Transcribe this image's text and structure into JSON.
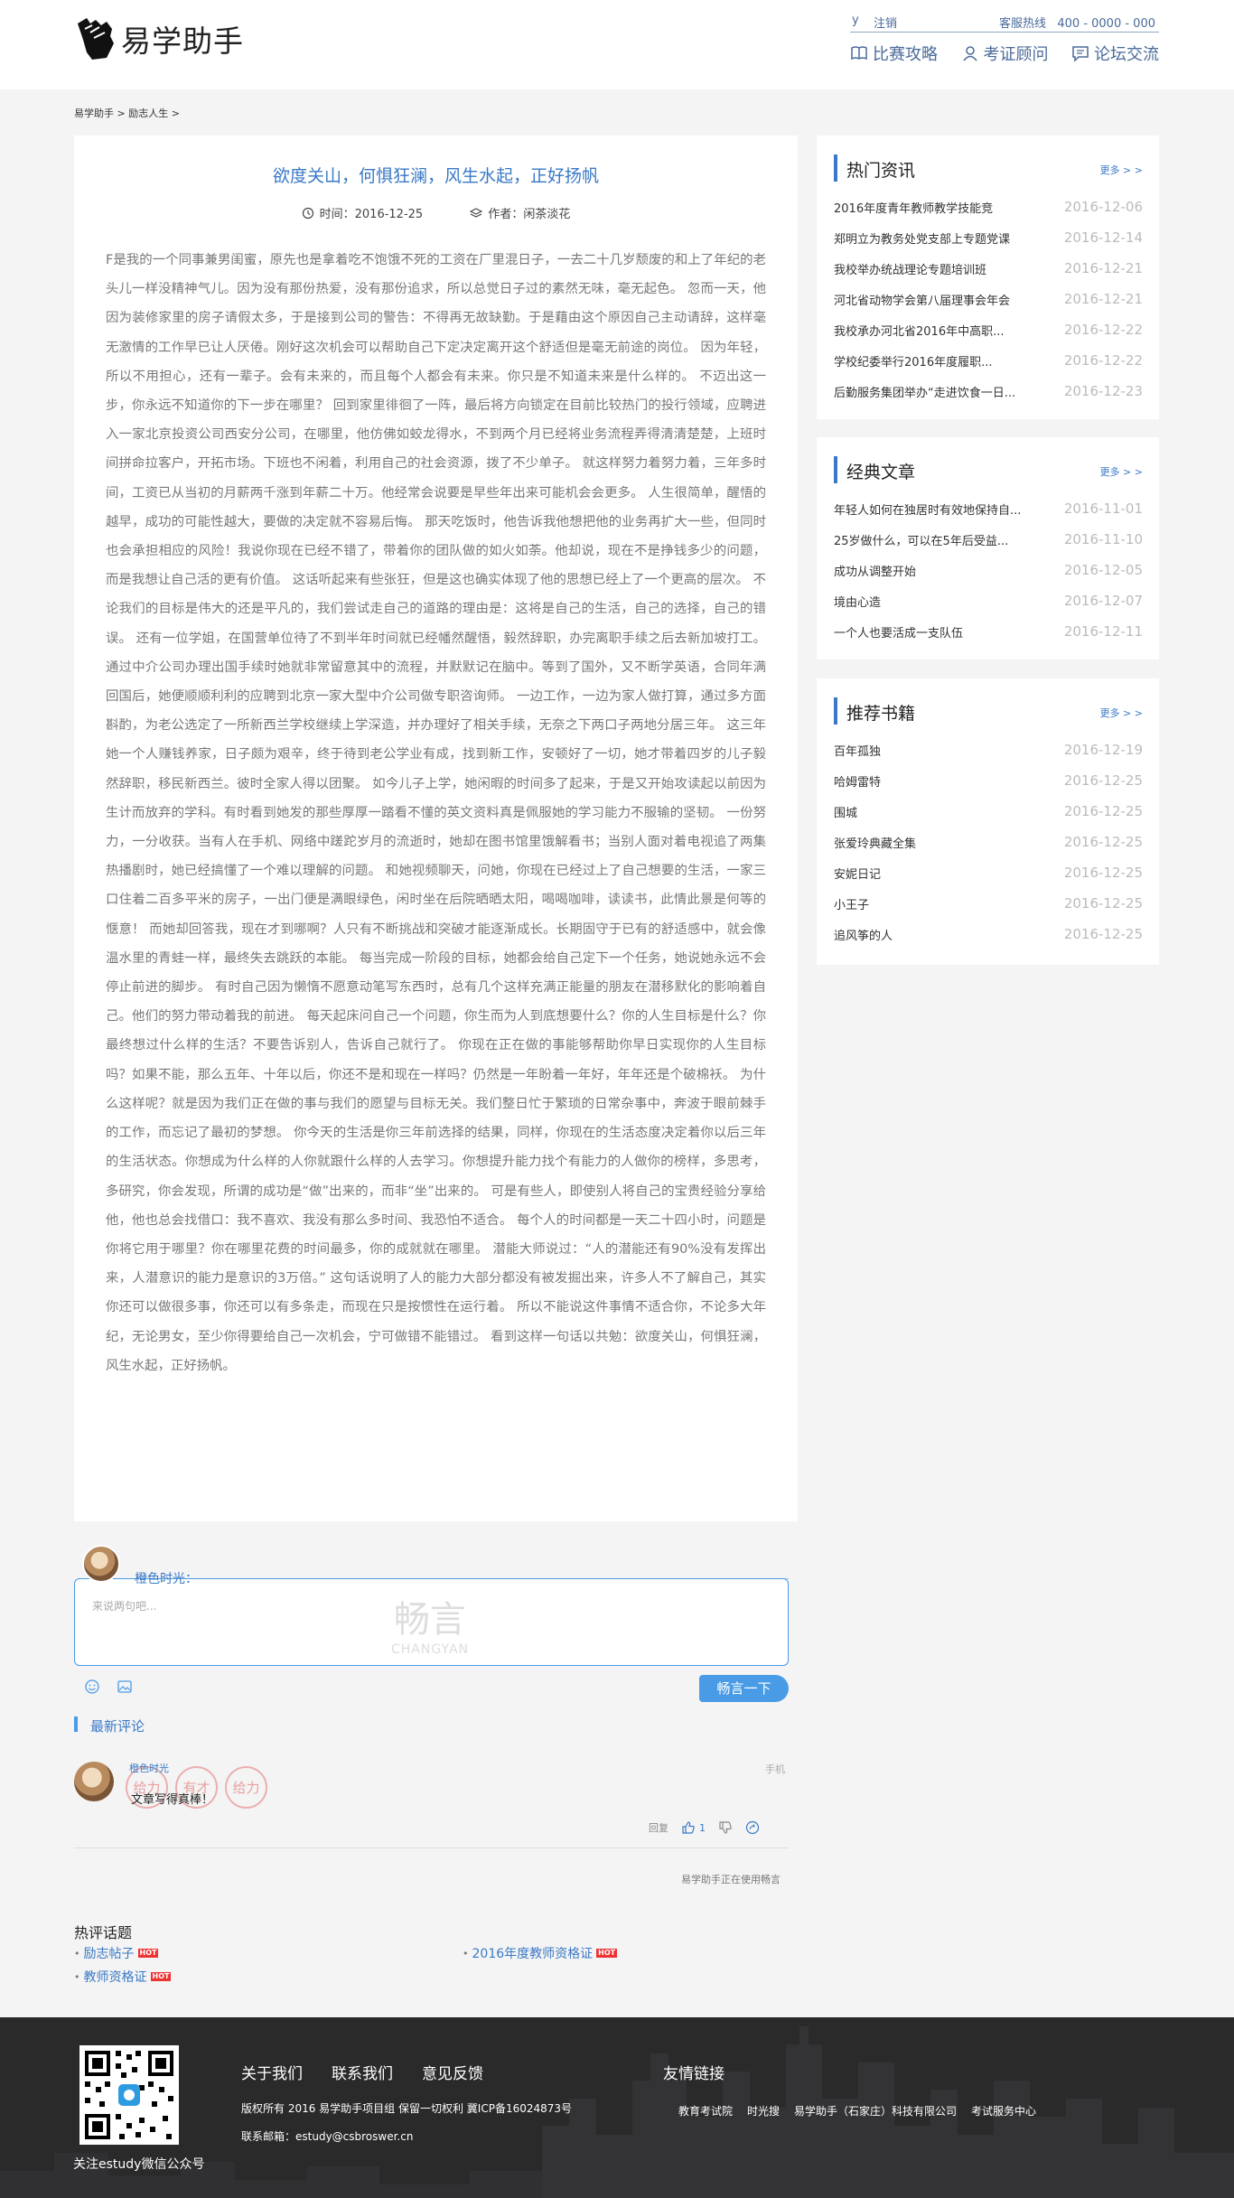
{
  "header": {
    "logo_text": "易学助手",
    "user": "y",
    "logout": "注销",
    "hotline_label": "客服热线",
    "hotline": "400 - 0000 - 000",
    "nav": [
      {
        "label": "比赛攻略",
        "icon": "book-icon"
      },
      {
        "label": "考证顾问",
        "icon": "user-icon"
      },
      {
        "label": "论坛交流",
        "icon": "chat-icon"
      }
    ]
  },
  "breadcrumb": [
    "易学助手",
    ">",
    "励志人生",
    ">"
  ],
  "article": {
    "title": "欲度关山，何惧狂澜，风生水起，正好扬帆",
    "time_label": "时间：2016-12-25",
    "author_label": "作者：闲茶淡花",
    "body": "F是我的一个同事兼男闺蜜，原先也是拿着吃不饱饿不死的工资在厂里混日子，一去二十几岁颓废的和上了年纪的老头儿一样没精神气儿。因为没有那份热爱，没有那份追求，所以总觉日子过的素然无味，毫无起色。 忽而一天，他因为装修家里的房子请假太多，于是接到公司的警告：不得再无故缺勤。于是藉由这个原因自己主动请辞，这样毫无激情的工作早已让人厌倦。刚好这次机会可以帮助自己下定决定离开这个舒适但是毫无前途的岗位。 因为年轻，所以不用担心，还有一辈子。会有未来的，而且每个人都会有未来。你只是不知道未来是什么样的。 不迈出这一步，你永远不知道你的下一步在哪里？ 回到家里徘徊了一阵，最后将方向锁定在目前比较热门的投行领域，应聘进入一家北京投资公司西安分公司，在哪里，他仿佛如蛟龙得水，不到两个月已经将业务流程弄得清清楚楚，上班时间拼命拉客户，开拓市场。下班也不闲着，利用自己的社会资源，拨了不少单子。 就这样努力着努力着，三年多时间，工资已从当初的月薪两千涨到年薪二十万。他经常会说要是早些年出来可能机会会更多。 人生很简单，醒悟的越早，成功的可能性越大，要做的决定就不容易后悔。 那天吃饭时，他告诉我他想把他的业务再扩大一些，但同时也会承担相应的风险！我说你现在已经不错了，带着你的团队做的如火如荼。他却说，现在不是挣钱多少的问题，而是我想让自己活的更有价值。 这话听起来有些张狂，但是这也确实体现了他的思想已经上了一个更高的层次。 不论我们的目标是伟大的还是平凡的，我们尝试走自己的道路的理由是：这将是自己的生活，自己的选择，自己的错误。 还有一位学姐，在国营单位待了不到半年时间就已经幡然醒悟，毅然辞职，办完离职手续之后去新加坡打工。 通过中介公司办理出国手续时她就非常留意其中的流程，并默默记在脑中。等到了国外，又不断学英语，合同年满回国后，她便顺顺利利的应聘到北京一家大型中介公司做专职咨询师。 一边工作，一边为家人做打算，通过多方面斟酌，为老公选定了一所新西兰学校继续上学深造，并办理好了相关手续，无奈之下两口子两地分居三年。 这三年她一个人赚钱养家，日子颇为艰辛，终于待到老公学业有成，找到新工作，安顿好了一切，她才带着四岁的儿子毅然辞职，移民新西兰。彼时全家人得以团聚。 如今儿子上学，她闲暇的时间多了起来，于是又开始攻读起以前因为生计而放弃的学科。有时看到她发的那些厚厚一踏看不懂的英文资料真是佩服她的学习能力不服输的坚韧。 一份努力，一分收获。当有人在手机、网络中蹉跎岁月的流逝时，她却在图书馆里饿解看书；当别人面对着电视追了两集热播剧时，她已经搞懂了一个难以理解的问题。 和她视频聊天，问她，你现在已经过上了自己想要的生活，一家三口住着二百多平米的房子，一出门便是满眼绿色，闲时坐在后院晒晒太阳，喝喝咖啡，读读书，此情此景是何等的惬意！ 而她却回答我，现在才到哪啊？人只有不断挑战和突破才能逐渐成长。长期固守于已有的舒适感中，就会像温水里的青蛙一样，最终失去跳跃的本能。 每当完成一阶段的目标，她都会给自己定下一个任务，她说她永远不会停止前进的脚步。 有时自己因为懒惰不愿意动笔写东西时，总有几个这样充满正能量的朋友在潜移默化的影响着自己。他们的努力带动着我的前进。 每天起床问自己一个问题，你生而为人到底想要什么？你的人生目标是什么？你最终想过什么样的生活？不要告诉别人，告诉自己就行了。 你现在正在做的事能够帮助你早日实现你的人生目标吗？如果不能，那么五年、十年以后，你还不是和现在一样吗？仍然是一年盼着一年好，年年还是个破棉袄。 为什么这样呢？就是因为我们正在做的事与我们的愿望与目标无关。我们整日忙于繁琐的日常杂事中，奔波于眼前棘手的工作，而忘记了最初的梦想。 你今天的生活是你三年前选择的结果，同样，你现在的生活态度决定着你以后三年的生活状态。你想成为什么样的人你就跟什么样的人去学习。你想提升能力找个有能力的人做你的榜样，多思考，多研究，你会发现，所谓的成功是“做”出来的，而非“坐”出来的。 可是有些人，即使别人将自己的宝贵经验分享给他，他也总会找借口：我不喜欢、我没有那么多时间、我恐怕不适合。 每个人的时间都是一天二十四小时，问题是你将它用于哪里？你在哪里花费的时间最多，你的成就就在哪里。 潜能大师说过：“人的潜能还有90%没有发挥出来，人潜意识的能力是意识的3万倍。” 这句话说明了人的能力大部分都没有被发掘出来，许多人不了解自己，其实你还可以做很多事，你还可以有多条走，而现在只是按惯性在运行着。 所以不能说这件事情不适合你，不论多大年纪，无论男女，至少你得要给自己一次机会，宁可做错不能错过。 看到这样一句话以共勉：欲度关山，何惧狂澜，风生水起，正好扬帆。"
  },
  "sidebar": [
    {
      "title": "热门资讯",
      "more": "更多 > >",
      "items": [
        {
          "title": "2016年度青年教师教学技能竞",
          "date": "2016-12-06"
        },
        {
          "title": "郑明立为教务处党支部上专题党课",
          "date": "2016-12-14"
        },
        {
          "title": "我校举办统战理论专题培训班",
          "date": "2016-12-21"
        },
        {
          "title": "河北省动物学会第八届理事会年会",
          "date": "2016-12-21"
        },
        {
          "title": "我校承办河北省2016年中高职...",
          "date": "2016-12-22"
        },
        {
          "title": "学校纪委举行2016年度履职...",
          "date": "2016-12-22"
        },
        {
          "title": "后勤服务集团举办“走进饮食一日...",
          "date": "2016-12-23"
        }
      ]
    },
    {
      "title": "经典文章",
      "more": "更多 > >",
      "items": [
        {
          "title": "年轻人如何在独居时有效地保持自...",
          "date": "2016-11-01"
        },
        {
          "title": "25岁做什么，可以在5年后受益...",
          "date": "2016-11-10"
        },
        {
          "title": "成功从调整开始",
          "date": "2016-12-05"
        },
        {
          "title": "境由心造",
          "date": "2016-12-07"
        },
        {
          "title": "一个人也要活成一支队伍",
          "date": "2016-12-11"
        }
      ]
    },
    {
      "title": "推荐书籍",
      "more": "更多 > >",
      "items": [
        {
          "title": "百年孤独",
          "date": "2016-12-19"
        },
        {
          "title": "哈姆雷特",
          "date": "2016-12-25"
        },
        {
          "title": "围城",
          "date": "2016-12-25"
        },
        {
          "title": "张爱玲典藏全集",
          "date": "2016-12-25"
        },
        {
          "title": "安妮日记",
          "date": "2016-12-25"
        },
        {
          "title": "小王子",
          "date": "2016-12-25"
        },
        {
          "title": "追风筝的人",
          "date": "2016-12-25"
        }
      ]
    }
  ],
  "comments": {
    "user_name": "橙色时光：",
    "placeholder": "来说两句吧...",
    "watermark": "畅言",
    "watermark_en": "CHANGYAN",
    "submit": "畅言一下",
    "latest_title": "最新评论",
    "entry": {
      "user": "橙色时光",
      "text": "文章写得真棒！",
      "badges": [
        "给力",
        "有才",
        "给力"
      ],
      "tag": "手机",
      "reply": "回复",
      "likes": "1"
    },
    "powered": "易学助手正在使用畅言"
  },
  "hot_topics": {
    "title": "热评话题",
    "items": [
      {
        "label": "励志帖子",
        "badge": "HOT"
      },
      {
        "label": "教师资格证",
        "badge": "HOT"
      },
      {
        "label": "2016年度教师资格证",
        "badge": "HOT"
      }
    ]
  },
  "footer": {
    "qr_label": "关注estudy微信公众号",
    "links": [
      "关于我们",
      "联系我们",
      "意见反馈"
    ],
    "copyright": "版权所有 2016 易学助手项目组 保留一切权利 冀ICP备16024873号",
    "email": "联系邮箱：estudy@csbroswer.cn",
    "friend_title": "友情链接",
    "friends": [
      "教育考试院",
      "时光搜",
      "易学助手（石家庄）科技有限公司",
      "考试服务中心"
    ]
  },
  "colors": {
    "accent": "#3a79c6",
    "button": "#4a9be6",
    "footer_bg": "#2a2a2b",
    "page_bg": "#f4f4f4"
  }
}
